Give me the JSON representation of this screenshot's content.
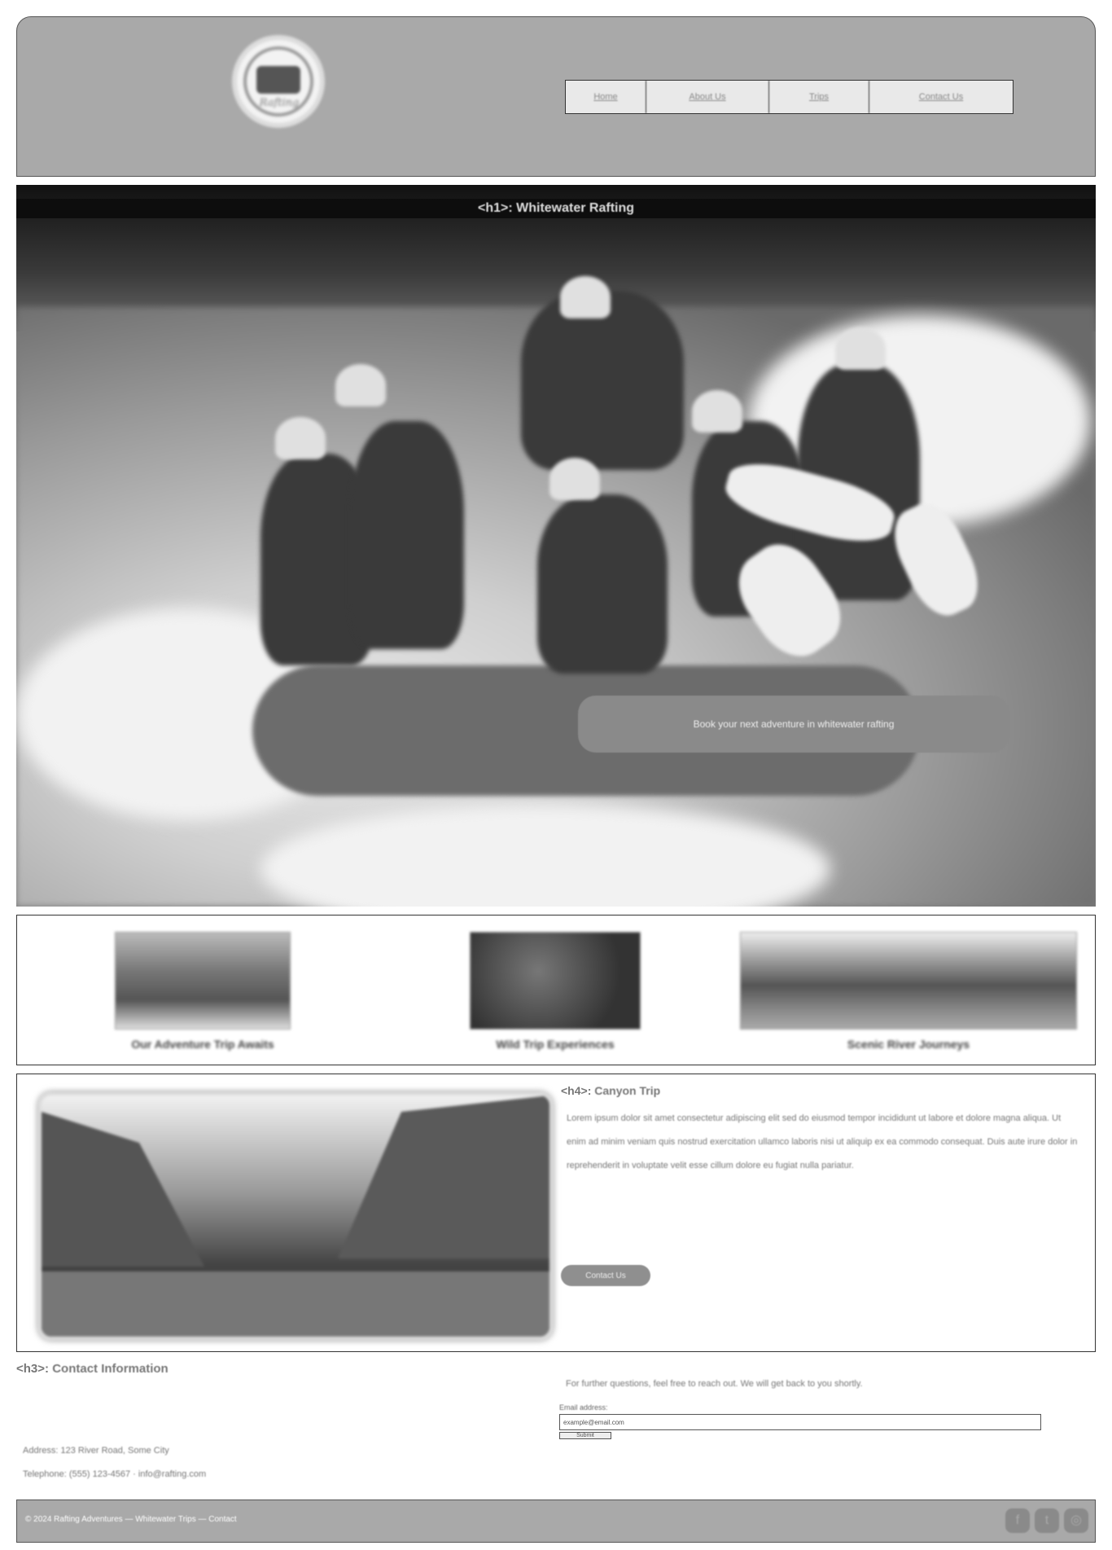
{
  "header": {
    "logo_word": "Rafting",
    "nav": [
      {
        "label": "Home",
        "width": 98
      },
      {
        "label": "About Us",
        "width": 150
      },
      {
        "label": "Trips",
        "width": 122
      },
      {
        "label": "Contact Us",
        "width": 176
      }
    ]
  },
  "hero": {
    "h1_tag": "<h1>:",
    "h1_text": "Whitewater Rafting",
    "caption": "Book your next adventure in whitewater rafting"
  },
  "thumbs": [
    {
      "caption": "Our Adventure Trip Awaits"
    },
    {
      "caption": "Wild Trip Experiences"
    },
    {
      "caption": "Scenic River Journeys"
    }
  ],
  "feature": {
    "h4_tag": "<h4>:",
    "h4_text": "Canyon Trip",
    "body": "Lorem ipsum dolor sit amet consectetur adipiscing elit sed do eiusmod tempor incididunt ut labore et dolore magna aliqua. Ut enim ad minim veniam quis nostrud exercitation ullamco laboris nisi ut aliquip ex ea commodo consequat. Duis aute irure dolor in reprehenderit in voluptate velit esse cillum dolore eu fugiat nulla pariatur.",
    "button": "Contact Us"
  },
  "contact": {
    "h3_tag": "<h3>:",
    "h3_text": "Contact Information",
    "address_line1": "Address: 123 River Road, Some City",
    "address_line2": "Telephone: (555) 123-4567 · info@rafting.com",
    "intro": "For further questions, feel free to reach out. We will get back to you shortly.",
    "email_label": "Email address:",
    "email_value": "example@email.com",
    "submit": "Submit"
  },
  "footer": {
    "copy": "© 2024 Rafting Adventures — Whitewater Trips — Contact",
    "social": [
      {
        "icon": "facebook-icon",
        "glyph": "f"
      },
      {
        "icon": "twitter-icon",
        "glyph": "t"
      },
      {
        "icon": "instagram-icon",
        "glyph": "◎"
      }
    ]
  }
}
